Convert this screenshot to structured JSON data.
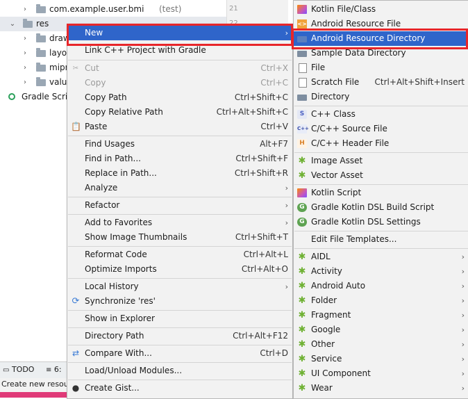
{
  "tree": {
    "rows": [
      {
        "label": "com.example.user.bmi",
        "suffix": "(test)",
        "chev": "›"
      },
      {
        "label": "res",
        "suffix": "",
        "chev": "⌄"
      },
      {
        "label": "draw",
        "suffix": "",
        "chev": "›"
      },
      {
        "label": "layou",
        "suffix": "",
        "chev": "›"
      },
      {
        "label": "mipr",
        "suffix": "",
        "chev": "›"
      },
      {
        "label": "value",
        "suffix": "",
        "chev": "›"
      },
      {
        "label": "Gradle Scrip",
        "suffix": "",
        "chev": ""
      }
    ],
    "line_numbers": [
      "21",
      "22"
    ],
    "bottom_tabs": {
      "todo": "TODO",
      "six": "6:"
    },
    "status_text": "Create new resou"
  },
  "menu1": {
    "items": [
      {
        "label": "New",
        "shortcut": "",
        "submenu": true,
        "selected": true
      },
      {
        "label": "Link C++ Project with Gradle",
        "shortcut": ""
      },
      {
        "label": "Cut",
        "shortcut": "Ctrl+X",
        "disabled": true
      },
      {
        "label": "Copy",
        "shortcut": "Ctrl+C",
        "disabled": true
      },
      {
        "label": "Copy Path",
        "shortcut": "Ctrl+Shift+C"
      },
      {
        "label": "Copy Relative Path",
        "shortcut": "Ctrl+Alt+Shift+C"
      },
      {
        "label": "Paste",
        "shortcut": "Ctrl+V"
      },
      {
        "label": "Find Usages",
        "shortcut": "Alt+F7"
      },
      {
        "label": "Find in Path...",
        "shortcut": "Ctrl+Shift+F"
      },
      {
        "label": "Replace in Path...",
        "shortcut": "Ctrl+Shift+R"
      },
      {
        "label": "Analyze",
        "shortcut": "",
        "submenu": true
      },
      {
        "label": "Refactor",
        "shortcut": "",
        "submenu": true
      },
      {
        "label": "Add to Favorites",
        "shortcut": "",
        "submenu": true
      },
      {
        "label": "Show Image Thumbnails",
        "shortcut": "Ctrl+Shift+T"
      },
      {
        "label": "Reformat Code",
        "shortcut": "Ctrl+Alt+L"
      },
      {
        "label": "Optimize Imports",
        "shortcut": "Ctrl+Alt+O"
      },
      {
        "label": "Local History",
        "shortcut": "",
        "submenu": true
      },
      {
        "label": "Synchronize 'res'",
        "shortcut": ""
      },
      {
        "label": "Show in Explorer",
        "shortcut": ""
      },
      {
        "label": "Directory Path",
        "shortcut": "Ctrl+Alt+F12"
      },
      {
        "label": "Compare With...",
        "shortcut": "Ctrl+D"
      },
      {
        "label": "Load/Unload Modules...",
        "shortcut": ""
      },
      {
        "label": "Create Gist...",
        "shortcut": ""
      }
    ]
  },
  "menu2": {
    "items": [
      {
        "label": "Kotlin File/Class",
        "icon": "kotlin-icon"
      },
      {
        "label": "Android Resource File",
        "icon": "resource-file-icon"
      },
      {
        "label": "Android Resource Directory",
        "icon": "folder-icon",
        "selected": true
      },
      {
        "label": "Sample Data Directory",
        "icon": "folder-icon"
      },
      {
        "label": "File",
        "icon": "file-icon"
      },
      {
        "label": "Scratch File",
        "icon": "scratch-file-icon",
        "shortcut": "Ctrl+Alt+Shift+Insert"
      },
      {
        "label": "Directory",
        "icon": "folder-icon"
      },
      {
        "label": "C++ Class",
        "icon": "cpp-class-icon"
      },
      {
        "label": "C/C++ Source File",
        "icon": "cpp-source-icon"
      },
      {
        "label": "C/C++ Header File",
        "icon": "header-file-icon"
      },
      {
        "label": "Image Asset",
        "icon": "android-icon"
      },
      {
        "label": "Vector Asset",
        "icon": "android-icon"
      },
      {
        "label": "Kotlin Script",
        "icon": "kotlin-icon"
      },
      {
        "label": "Gradle Kotlin DSL Build Script",
        "icon": "gradle-icon"
      },
      {
        "label": "Gradle Kotlin DSL Settings",
        "icon": "gradle-icon"
      },
      {
        "label": "Edit File Templates...",
        "icon": ""
      },
      {
        "label": "AIDL",
        "icon": "android-icon",
        "submenu": true
      },
      {
        "label": "Activity",
        "icon": "android-icon",
        "submenu": true
      },
      {
        "label": "Android Auto",
        "icon": "android-icon",
        "submenu": true
      },
      {
        "label": "Folder",
        "icon": "android-icon",
        "submenu": true
      },
      {
        "label": "Fragment",
        "icon": "android-icon",
        "submenu": true
      },
      {
        "label": "Google",
        "icon": "android-icon",
        "submenu": true
      },
      {
        "label": "Other",
        "icon": "android-icon",
        "submenu": true
      },
      {
        "label": "Service",
        "icon": "android-icon",
        "submenu": true
      },
      {
        "label": "UI Component",
        "icon": "android-icon",
        "submenu": true
      },
      {
        "label": "Wear",
        "icon": "android-icon",
        "submenu": true
      }
    ]
  },
  "colors": {
    "selection": "#2f65ca",
    "highlight_box": "#e8262a",
    "menu_bg": "#f2f2f2"
  }
}
